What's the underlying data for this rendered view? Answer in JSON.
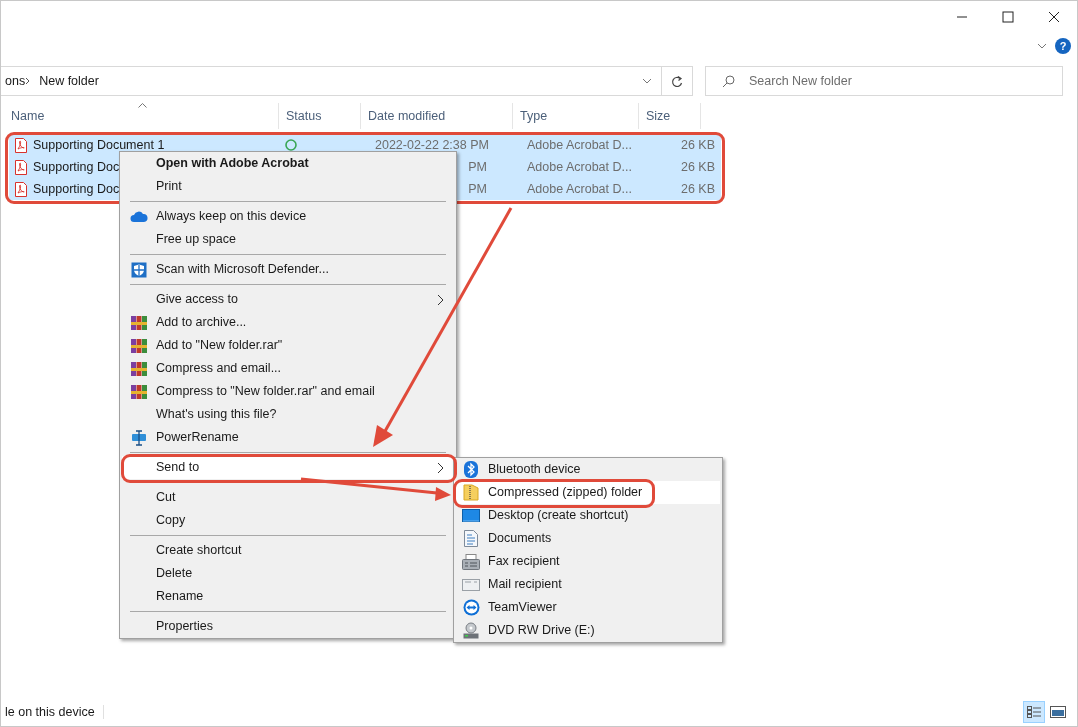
{
  "ribbon": {
    "help": "?"
  },
  "address_bar": {
    "path": [
      "ons",
      "New folder"
    ]
  },
  "search": {
    "placeholder": "Search New folder"
  },
  "columns": [
    "Name",
    "Status",
    "Date modified",
    "Type",
    "Size"
  ],
  "rows": [
    {
      "name": "Supporting Document 1",
      "synced": true,
      "date": "2022-02-22 2:38 PM",
      "type": "Adobe Acrobat D...",
      "size": "26 KB",
      "selected": true
    },
    {
      "name": "Supporting Doc",
      "date": "PM",
      "type": "Adobe Acrobat D...",
      "size": "26 KB",
      "selected": true
    },
    {
      "name": "Supporting Doc",
      "date": "PM",
      "type": "Adobe Acrobat D...",
      "size": "26 KB",
      "selected": true
    }
  ],
  "context_menu": [
    {
      "kind": "default",
      "label": "Open with Adobe Acrobat",
      "highlighted": false
    },
    {
      "kind": "plain",
      "label": "Print",
      "highlighted": false
    },
    {
      "kind": "separator"
    },
    {
      "kind": "cloud",
      "label": "Always keep on this device",
      "highlighted": false
    },
    {
      "kind": "plain",
      "label": "Free up space",
      "highlighted": false
    },
    {
      "kind": "separator"
    },
    {
      "kind": "shield",
      "label": "Scan with Microsoft Defender...",
      "highlighted": false
    },
    {
      "kind": "separator"
    },
    {
      "kind": "submenu",
      "label": "Give access to",
      "highlighted": false
    },
    {
      "kind": "archive",
      "label": "Add to archive...",
      "highlighted": false
    },
    {
      "kind": "archive",
      "label": "Add to \"New folder.rar\"",
      "highlighted": false
    },
    {
      "kind": "archive",
      "label": "Compress and email...",
      "highlighted": false
    },
    {
      "kind": "archive",
      "label": "Compress to \"New folder.rar\" and email",
      "highlighted": false
    },
    {
      "kind": "plain",
      "label": "What's using this file?",
      "highlighted": false
    },
    {
      "kind": "rename",
      "label": "PowerRename",
      "highlighted": false
    },
    {
      "kind": "separator"
    },
    {
      "kind": "submenu",
      "label": "Send to",
      "highlighted": true
    },
    {
      "kind": "separator"
    },
    {
      "kind": "plain",
      "label": "Cut",
      "highlighted": false
    },
    {
      "kind": "plain",
      "label": "Copy",
      "highlighted": false
    },
    {
      "kind": "separator"
    },
    {
      "kind": "plain",
      "label": "Create shortcut",
      "highlighted": false
    },
    {
      "kind": "plain",
      "label": "Delete",
      "highlighted": false
    },
    {
      "kind": "plain",
      "label": "Rename",
      "highlighted": false
    },
    {
      "kind": "separator"
    },
    {
      "kind": "plain",
      "label": "Properties",
      "highlighted": false
    }
  ],
  "send_to_menu": [
    {
      "kind": "bluetooth",
      "label": "Bluetooth device",
      "highlighted": false
    },
    {
      "kind": "zip",
      "label": "Compressed (zipped) folder",
      "highlighted": true
    },
    {
      "kind": "desktop",
      "label": "Desktop (create shortcut)",
      "highlighted": false
    },
    {
      "kind": "documents",
      "label": "Documents",
      "highlighted": false
    },
    {
      "kind": "fax",
      "label": "Fax recipient",
      "highlighted": false
    },
    {
      "kind": "mail",
      "label": "Mail recipient",
      "highlighted": false
    },
    {
      "kind": "teamviewer",
      "label": "TeamViewer",
      "highlighted": false
    },
    {
      "kind": "dvd",
      "label": "DVD RW Drive (E:)",
      "highlighted": false
    }
  ],
  "status_bar": {
    "text": "le on this device",
    "views": [
      {
        "kind": "details",
        "selected": true
      },
      {
        "kind": "preview",
        "selected": false
      }
    ]
  }
}
